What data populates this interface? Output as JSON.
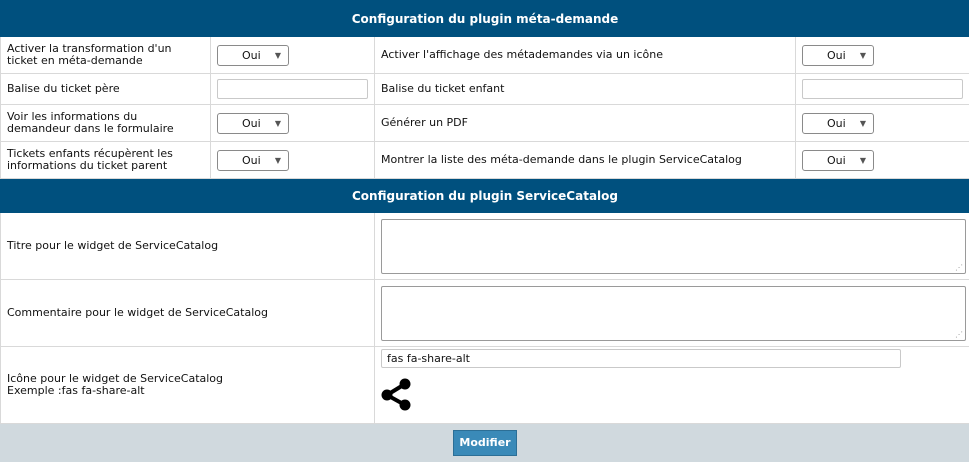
{
  "section1": {
    "title": "Configuration du plugin méta-demande",
    "rows": [
      {
        "left_label": "Activer la transformation d'un ticket en méta-demande",
        "left_value": "Oui",
        "right_label": "Activer l'affichage des métademandes via un icône",
        "right_value": "Oui"
      },
      {
        "left_label": "Balise du ticket père",
        "left_value": "",
        "right_label": "Balise du ticket enfant",
        "right_value": ""
      },
      {
        "left_label": "Voir les informations du demandeur dans le formulaire",
        "left_value": "Oui",
        "right_label": "Générer un PDF",
        "right_value": "Oui"
      },
      {
        "left_label": "Tickets enfants récupèrent les informations du ticket parent",
        "left_value": "Oui",
        "right_label": "Montrer la liste des méta-demande dans le plugin ServiceCatalog",
        "right_value": "Oui"
      }
    ]
  },
  "section2": {
    "title": "Configuration du plugin ServiceCatalog",
    "widget_title_label": "Titre pour le widget de ServiceCatalog",
    "widget_title_value": "",
    "widget_comment_label": "Commentaire pour le widget de ServiceCatalog",
    "widget_comment_value": "",
    "widget_icon_label": "Icône pour le widget de ServiceCatalog",
    "widget_icon_example": "Exemple :fas fa-share-alt",
    "widget_icon_value": "fas fa-share-alt",
    "icon_preview": "share-alt-icon"
  },
  "footer": {
    "submit_label": "Modifier"
  }
}
